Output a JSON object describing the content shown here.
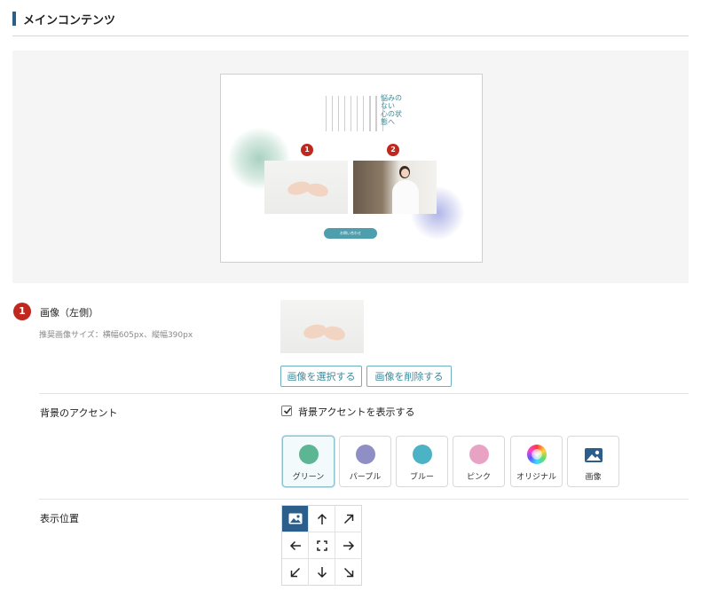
{
  "section": {
    "title": "メインコンテンツ"
  },
  "preview": {
    "title_lines": [
      "悩みのない",
      "心の状態へ"
    ],
    "button_label": "お問い合わせ",
    "marker_1": "1",
    "marker_2": "2"
  },
  "image_left": {
    "badge": "1",
    "label": "画像（左側）",
    "hint": "推奨画像サイズ：横幅605px、縦幅390px",
    "select_button": "画像を選択する",
    "delete_button": "画像を削除する"
  },
  "accent": {
    "label": "背景のアクセント",
    "checkbox_label": "背景アクセントを表示する",
    "checked": true,
    "selected": "グリーン",
    "options": [
      {
        "label": "グリーン",
        "color": "#5cb593",
        "icon": "green-swatch"
      },
      {
        "label": "パープル",
        "color": "#8f8fc6",
        "icon": "purple-swatch"
      },
      {
        "label": "ブルー",
        "color": "#4bb3c3",
        "icon": "blue-swatch"
      },
      {
        "label": "ピンク",
        "color": "#e8a3c4",
        "icon": "pink-swatch"
      },
      {
        "label": "オリジナル",
        "color": "conic-gradient",
        "icon": "color-wheel"
      },
      {
        "label": "画像",
        "color": "#2c5e8c",
        "icon": "image-icon"
      }
    ]
  },
  "position": {
    "label": "表示位置",
    "selected": "image",
    "cells": [
      "image-icon",
      "arrow-up-icon",
      "arrow-up-right-icon",
      "arrow-left-icon",
      "center-icon",
      "arrow-right-icon",
      "arrow-down-left-icon",
      "arrow-down-icon",
      "arrow-down-right-icon"
    ]
  },
  "colors": {
    "accent": "#2c5e8c",
    "badge": "#c0271e",
    "button_text": "#3a8a9c"
  }
}
